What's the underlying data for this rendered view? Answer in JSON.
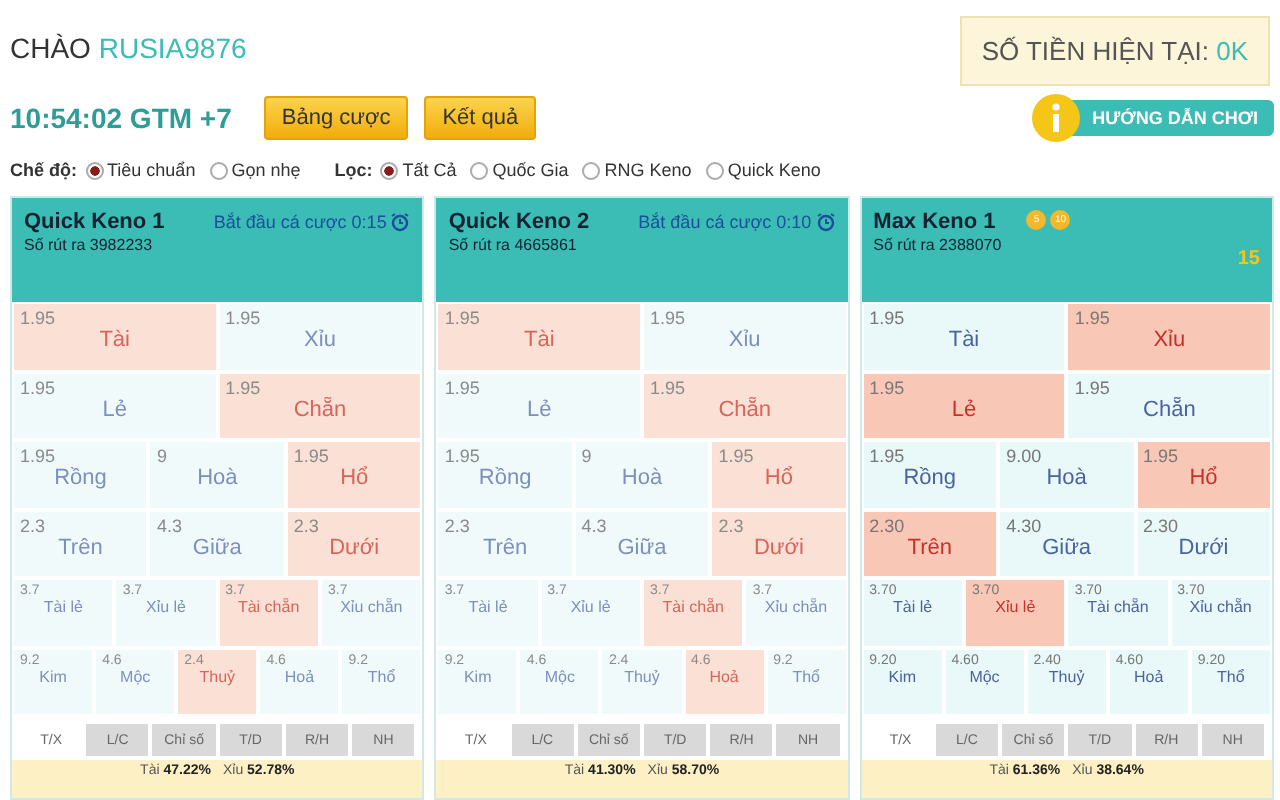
{
  "greeting": {
    "label": "CHÀO",
    "username": "RUSIA9876"
  },
  "balance": {
    "label": "SỐ TIỀN HIỆN TẠI:",
    "value": "0K"
  },
  "clock": "10:54:02 GTM +7",
  "buttons": [
    "Bảng cược",
    "Kết quả"
  ],
  "guide_button": "HƯỚNG DẪN CHƠI",
  "filters": [
    {
      "label": "Chế độ:",
      "options": [
        {
          "label": "Tiêu chuẩn",
          "selected": true
        },
        {
          "label": "Gọn nhẹ",
          "selected": false
        }
      ]
    },
    {
      "label": "Lọc:",
      "options": [
        {
          "label": "Tất Cả",
          "selected": true
        },
        {
          "label": "Quốc Gia",
          "selected": false
        },
        {
          "label": "RNG Keno",
          "selected": false
        },
        {
          "label": "Quick Keno",
          "selected": false
        }
      ]
    }
  ],
  "panels": [
    {
      "title": "Quick Keno 1",
      "draw": "Số rút ra 3982233",
      "timer": "Bắt đầu cá cược 0:15",
      "disabled": true,
      "bet_groups": [
        {
          "options": [
            {
              "odds": "1.95",
              "label": "Tài",
              "selected": true
            },
            {
              "odds": "1.95",
              "label": "Xỉu",
              "selected": false
            }
          ]
        },
        {
          "options": [
            {
              "odds": "1.95",
              "label": "Lẻ",
              "selected": false
            },
            {
              "odds": "1.95",
              "label": "Chẵn",
              "selected": true
            }
          ]
        },
        {
          "options": [
            {
              "odds": "1.95",
              "label": "Rồng",
              "selected": false
            },
            {
              "odds": "9",
              "label": "Hoà",
              "selected": false
            },
            {
              "odds": "1.95",
              "label": "Hổ",
              "selected": true
            }
          ]
        },
        {
          "options": [
            {
              "odds": "2.3",
              "label": "Trên",
              "selected": false
            },
            {
              "odds": "4.3",
              "label": "Giữa",
              "selected": false
            },
            {
              "odds": "2.3",
              "label": "Dưới",
              "selected": true
            }
          ]
        },
        {
          "options": [
            {
              "odds": "3.7",
              "label": "Tài lẻ",
              "selected": false
            },
            {
              "odds": "3.7",
              "label": "Xỉu lẻ",
              "selected": false
            },
            {
              "odds": "3.7",
              "label": "Tài chẵn",
              "selected": true
            },
            {
              "odds": "3.7",
              "label": "Xỉu chẵn",
              "selected": false
            }
          ]
        },
        {
          "options": [
            {
              "odds": "9.2",
              "label": "Kim",
              "selected": false
            },
            {
              "odds": "4.6",
              "label": "Mộc",
              "selected": false
            },
            {
              "odds": "2.4",
              "label": "Thuỷ",
              "selected": true
            },
            {
              "odds": "4.6",
              "label": "Hoả",
              "selected": false
            },
            {
              "odds": "9.2",
              "label": "Thổ",
              "selected": false
            }
          ]
        }
      ],
      "tabs": [
        {
          "label": "T/X",
          "selected": true
        },
        {
          "label": "L/C",
          "selected": false
        },
        {
          "label": "Chỉ số",
          "selected": false
        },
        {
          "label": "T/D",
          "selected": false
        },
        {
          "label": "R/H",
          "selected": false
        },
        {
          "label": "NH",
          "selected": false
        }
      ],
      "stats": [
        "Tài **47.22%**",
        "Xỉu **52.78%**"
      ]
    },
    {
      "title": "Quick Keno 2",
      "draw": "Số rút ra 4665861",
      "timer": "Bắt đầu cá cược 0:10",
      "disabled": true,
      "bet_groups": [
        {
          "options": [
            {
              "odds": "1.95",
              "label": "Tài",
              "selected": true
            },
            {
              "odds": "1.95",
              "label": "Xỉu",
              "selected": false
            }
          ]
        },
        {
          "options": [
            {
              "odds": "1.95",
              "label": "Lẻ",
              "selected": false
            },
            {
              "odds": "1.95",
              "label": "Chẵn",
              "selected": true
            }
          ]
        },
        {
          "options": [
            {
              "odds": "1.95",
              "label": "Rồng",
              "selected": false
            },
            {
              "odds": "9",
              "label": "Hoà",
              "selected": false
            },
            {
              "odds": "1.95",
              "label": "Hổ",
              "selected": true
            }
          ]
        },
        {
          "options": [
            {
              "odds": "2.3",
              "label": "Trên",
              "selected": false
            },
            {
              "odds": "4.3",
              "label": "Giữa",
              "selected": false
            },
            {
              "odds": "2.3",
              "label": "Dưới",
              "selected": true
            }
          ]
        },
        {
          "options": [
            {
              "odds": "3.7",
              "label": "Tài lẻ",
              "selected": false
            },
            {
              "odds": "3.7",
              "label": "Xỉu lẻ",
              "selected": false
            },
            {
              "odds": "3.7",
              "label": "Tài chẵn",
              "selected": true
            },
            {
              "odds": "3.7",
              "label": "Xỉu chẵn",
              "selected": false
            }
          ]
        },
        {
          "options": [
            {
              "odds": "9.2",
              "label": "Kim",
              "selected": false
            },
            {
              "odds": "4.6",
              "label": "Mộc",
              "selected": false
            },
            {
              "odds": "2.4",
              "label": "Thuỷ",
              "selected": false
            },
            {
              "odds": "4.6",
              "label": "Hoả",
              "selected": true
            },
            {
              "odds": "9.2",
              "label": "Thổ",
              "selected": false
            }
          ]
        }
      ],
      "tabs": [
        {
          "label": "T/X",
          "selected": true
        },
        {
          "label": "L/C",
          "selected": false
        },
        {
          "label": "Chỉ số",
          "selected": false
        },
        {
          "label": "T/D",
          "selected": false
        },
        {
          "label": "R/H",
          "selected": false
        },
        {
          "label": "NH",
          "selected": false
        }
      ],
      "stats": [
        "Tài **41.30%**",
        "Xỉu **58.70%**"
      ]
    },
    {
      "title": "Max Keno 1",
      "draw": "Số rút ra 2388070",
      "chips": [
        "5",
        "10"
      ],
      "count": "15",
      "disabled": false,
      "bet_groups": [
        {
          "options": [
            {
              "odds": "1.95",
              "label": "Tài",
              "selected": false
            },
            {
              "odds": "1.95",
              "label": "Xỉu",
              "selected": true
            }
          ]
        },
        {
          "options": [
            {
              "odds": "1.95",
              "label": "Lẻ",
              "selected": true
            },
            {
              "odds": "1.95",
              "label": "Chẵn",
              "selected": false
            }
          ]
        },
        {
          "options": [
            {
              "odds": "1.95",
              "label": "Rồng",
              "selected": false
            },
            {
              "odds": "9.00",
              "label": "Hoà",
              "selected": false
            },
            {
              "odds": "1.95",
              "label": "Hổ",
              "selected": true
            }
          ]
        },
        {
          "options": [
            {
              "odds": "2.30",
              "label": "Trên",
              "selected": true
            },
            {
              "odds": "4.30",
              "label": "Giữa",
              "selected": false
            },
            {
              "odds": "2.30",
              "label": "Dưới",
              "selected": false
            }
          ]
        },
        {
          "options": [
            {
              "odds": "3.70",
              "label": "Tài lẻ",
              "selected": false
            },
            {
              "odds": "3.70",
              "label": "Xỉu lẻ",
              "selected": true
            },
            {
              "odds": "3.70",
              "label": "Tài chẵn",
              "selected": false
            },
            {
              "odds": "3.70",
              "label": "Xỉu chẵn",
              "selected": false
            }
          ]
        },
        {
          "options": [
            {
              "odds": "9.20",
              "label": "Kim",
              "selected": false
            },
            {
              "odds": "4.60",
              "label": "Mộc",
              "selected": false
            },
            {
              "odds": "2.40",
              "label": "Thuỷ",
              "selected": false
            },
            {
              "odds": "4.60",
              "label": "Hoả",
              "selected": false
            },
            {
              "odds": "9.20",
              "label": "Thổ",
              "selected": false
            }
          ]
        }
      ],
      "tabs": [
        {
          "label": "T/X",
          "selected": true
        },
        {
          "label": "L/C",
          "selected": false
        },
        {
          "label": "Chỉ số",
          "selected": false
        },
        {
          "label": "T/D",
          "selected": false
        },
        {
          "label": "R/H",
          "selected": false
        },
        {
          "label": "NH",
          "selected": false
        }
      ],
      "stats": [
        "Tài **61.36%**",
        "Xỉu **38.64%**"
      ]
    }
  ]
}
